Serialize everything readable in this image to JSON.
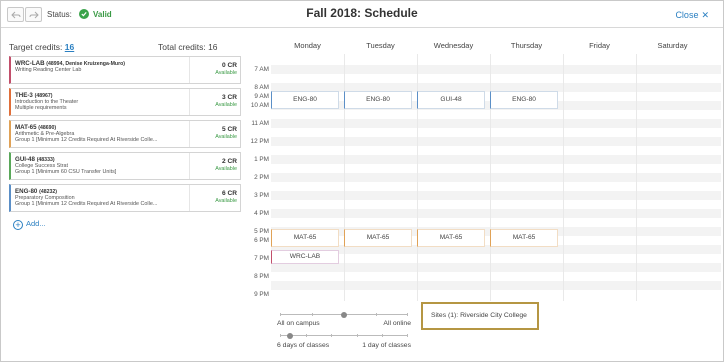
{
  "header": {
    "status_label": "Status:",
    "status_value": "Valid",
    "title": "Fall 2018: Schedule",
    "close_label": "Close"
  },
  "credits": {
    "target_label": "Target credits:",
    "target_value": "16",
    "total_label": "Total credits: 16"
  },
  "courses": [
    {
      "code": "WRC-LAB",
      "section": "(48994, Denise Kruizenga-Muro)",
      "line1": "Writing Reading Center Lab",
      "line2": "",
      "credits": "0 CR",
      "status": "Available",
      "color": "#c24f6b"
    },
    {
      "code": "THE-3",
      "section": "(48967)",
      "line1": "Introduction to the Theater",
      "line2": "Multiple requirements",
      "credits": "3 CR",
      "status": "Available",
      "color": "#e06f3a"
    },
    {
      "code": "MAT-65",
      "section": "(48690)",
      "line1": "Arithmetic & Pre-Algebra",
      "line2": "Group 1 [Minimum 12 Credits Required At Riverside Colle...",
      "credits": "5 CR",
      "status": "Available",
      "color": "#e0a257"
    },
    {
      "code": "GUI-48",
      "section": "(48333)",
      "line1": "College Success Strat",
      "line2": "Group 1 [Minimum 60 CSU Transfer Units]",
      "credits": "2 CR",
      "status": "Available",
      "color": "#5aa85a"
    },
    {
      "code": "ENG-80",
      "section": "(48232)",
      "line1": "Preparatory Composition",
      "line2": "Group 1 [Minimum 12 Credits Required At Riverside Colle...",
      "credits": "6 CR",
      "status": "Available",
      "color": "#5b8fc7"
    }
  ],
  "add_label": "Add...",
  "calendar": {
    "days": [
      "Monday",
      "Tuesday",
      "Wednesday",
      "Thursday",
      "Friday",
      "Saturday"
    ],
    "hours": [
      "7 AM",
      "8 AM",
      "9 AM",
      "10 AM",
      "11 AM",
      "12 PM",
      "1 PM",
      "2 PM",
      "3 PM",
      "4 PM",
      "5 PM",
      "6 PM",
      "7 PM",
      "8 PM",
      "9 PM"
    ],
    "events": {
      "eng_mon": "ENG-80",
      "eng_tue": "ENG-80",
      "gui_wed": "GUI-48",
      "eng_thu": "ENG-80",
      "mat_mon": "MAT-65",
      "mat_tue": "MAT-65",
      "mat_wed": "MAT-65",
      "mat_thu": "MAT-65",
      "wrc_mon": "WRC-LAB"
    }
  },
  "filters": {
    "campus_left": "All on campus",
    "campus_right": "All online",
    "days_left": "6 days of classes",
    "days_right": "1 day of classes",
    "sites": "Sites (1): Riverside City College"
  }
}
